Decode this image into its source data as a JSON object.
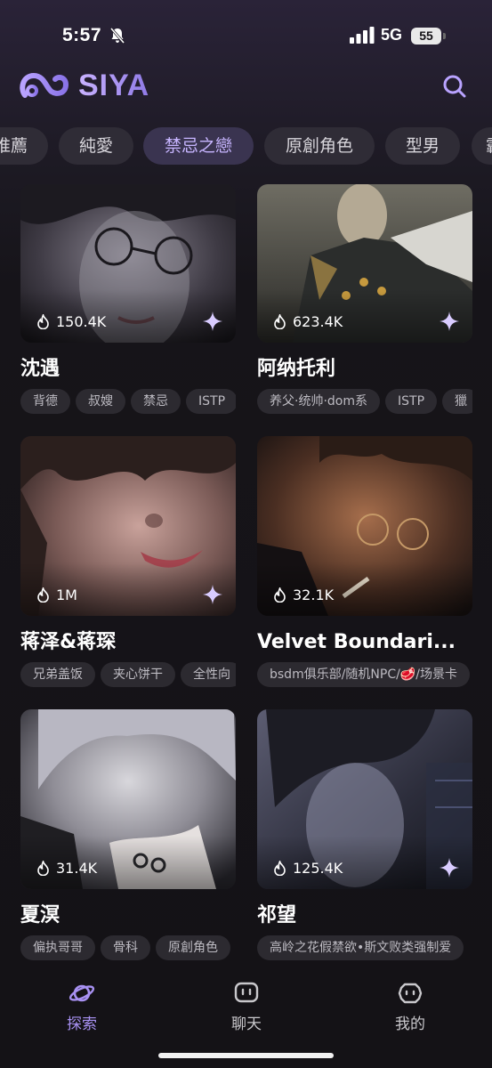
{
  "status_bar": {
    "time": "5:57",
    "network": "5G",
    "battery": "55"
  },
  "header": {
    "logo_text": "SIYA",
    "accent": "#a891f2"
  },
  "categories": {
    "items": [
      "推薦",
      "純愛",
      "禁忌之戀",
      "原創角色",
      "型男",
      "霸"
    ],
    "selected": "禁忌之戀"
  },
  "cards": [
    {
      "name": "沈遇",
      "count": "150.4K",
      "tags": [
        "背德",
        "叔嫂",
        "禁忌",
        "ISTP"
      ]
    },
    {
      "name": "阿纳托利",
      "count": "623.4K",
      "tags": [
        "养父·统帅·dom系",
        "ISTP",
        "獵"
      ]
    },
    {
      "name": "蒋泽&蒋琛",
      "count": "1M",
      "tags": [
        "兄弟盖饭",
        "夹心饼干",
        "全性向"
      ]
    },
    {
      "name": "Velvet Boundari...",
      "count": "32.1K",
      "tags": [
        "bsdm俱乐部/随机NPC/🥩/场景卡"
      ]
    },
    {
      "name": "夏溟",
      "count": "31.4K",
      "tags": [
        "偏执哥哥",
        "骨科",
        "原創角色"
      ]
    },
    {
      "name": "祁望",
      "count": "125.4K",
      "tags": [
        "高岭之花假禁欲•斯文败类强制爱"
      ]
    }
  ],
  "bottom_nav": {
    "items": [
      {
        "label": "探索",
        "icon": "planet-icon",
        "active": true
      },
      {
        "label": "聊天",
        "icon": "chat-icon",
        "active": false
      },
      {
        "label": "我的",
        "icon": "profile-icon",
        "active": false
      }
    ]
  }
}
